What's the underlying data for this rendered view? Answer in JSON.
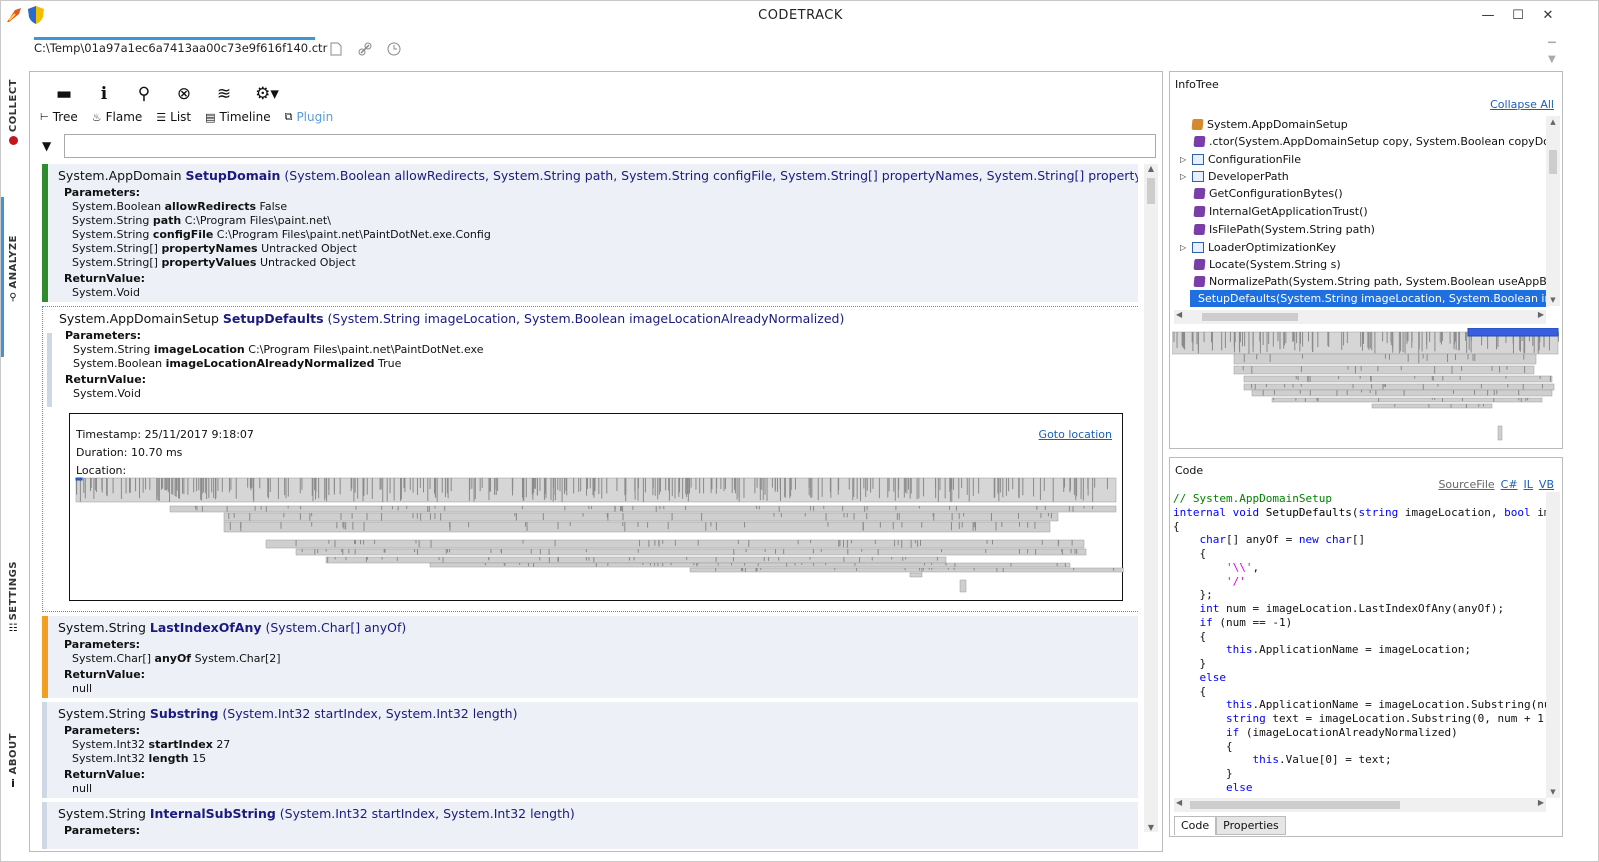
{
  "window": {
    "title": "CODETRACK",
    "controls": {
      "minimize": "—",
      "maximize": "☐",
      "close": "✕"
    }
  },
  "file_tab": {
    "label": "C:\\Temp\\01a97a1ec6a7413aa00c73e9f616f140.ctr"
  },
  "side_nav": [
    {
      "label": "COLLECT"
    },
    {
      "label": "ANALYZE"
    },
    {
      "label": "SETTINGS"
    },
    {
      "label": "ABOUT"
    }
  ],
  "view_tabs": [
    {
      "label": "Tree"
    },
    {
      "label": "Flame"
    },
    {
      "label": "List"
    },
    {
      "label": "Timeline"
    },
    {
      "label": "Plugin"
    }
  ],
  "filter": {
    "value": ""
  },
  "calls": [
    {
      "type": "System.AppDomain",
      "method": "SetupDomain",
      "params": "(System.Boolean allowRedirects, System.String path, System.String configFile, System.String[] propertyNames, System.String[] propertyValues)",
      "parameters_label": "Parameters:",
      "parameters": [
        {
          "ptype": "System.Boolean",
          "pname": "allowRedirects",
          "value": "False"
        },
        {
          "ptype": "System.String",
          "pname": "path",
          "value": "C:\\Program Files\\paint.net\\"
        },
        {
          "ptype": "System.String",
          "pname": "configFile",
          "value": "C:\\Program Files\\paint.net\\PaintDotNet.exe.Config"
        },
        {
          "ptype": "System.String[]",
          "pname": "propertyNames",
          "value": "Untracked Object"
        },
        {
          "ptype": "System.String[]",
          "pname": "propertyValues",
          "value": "Untracked Object"
        }
      ],
      "return_label": "ReturnValue:",
      "return_value": "System.Void",
      "bar_color": "#2e8b2e"
    },
    {
      "type": "System.AppDomainSetup",
      "method": "SetupDefaults",
      "params": "(System.String imageLocation, System.Boolean imageLocationAlreadyNormalized)",
      "parameters_label": "Parameters:",
      "parameters": [
        {
          "ptype": "System.String",
          "pname": "imageLocation",
          "value": "C:\\Program Files\\paint.net\\PaintDotNet.exe"
        },
        {
          "ptype": "System.Boolean",
          "pname": "imageLocationAlreadyNormalized",
          "value": "True"
        }
      ],
      "return_label": "ReturnValue:",
      "return_value": "System.Void",
      "details": {
        "timestamp": "Timestamp: 25/11/2017 9:18:07",
        "duration": "Duration: 10.70 ms",
        "location": "Location:",
        "goto": "Goto location"
      }
    },
    {
      "type": "System.String",
      "method": "LastIndexOfAny",
      "params": "(System.Char[] anyOf)",
      "parameters_label": "Parameters:",
      "parameters": [
        {
          "ptype": "System.Char[]",
          "pname": "anyOf",
          "value": "System.Char[2]"
        }
      ],
      "return_label": "ReturnValue:",
      "return_value": "null",
      "bar_color": "#f0a020"
    },
    {
      "type": "System.String",
      "method": "Substring",
      "params": "(System.Int32 startIndex, System.Int32 length)",
      "parameters_label": "Parameters:",
      "parameters": [
        {
          "ptype": "System.Int32",
          "pname": "startIndex",
          "value": "27"
        },
        {
          "ptype": "System.Int32",
          "pname": "length",
          "value": "15"
        }
      ],
      "return_label": "ReturnValue:",
      "return_value": "null"
    },
    {
      "type": "System.String",
      "method": "InternalSubString",
      "params": "(System.Int32 startIndex, System.Int32 length)",
      "parameters_label": "Parameters:"
    }
  ],
  "infotree": {
    "title": "InfoTree",
    "collapse_all": "Collapse All",
    "items": [
      {
        "label": "System.AppDomainSetup",
        "icon": "class",
        "expander": ""
      },
      {
        "label": ".ctor(System.AppDomainSetup copy, System.Boolean copyDomainBo",
        "icon": "method",
        "expander": ""
      },
      {
        "label": "ConfigurationFile",
        "icon": "property",
        "expander": "▷"
      },
      {
        "label": "DeveloperPath",
        "icon": "property",
        "expander": "▷"
      },
      {
        "label": "GetConfigurationBytes()",
        "icon": "method",
        "expander": ""
      },
      {
        "label": "InternalGetApplicationTrust()",
        "icon": "method",
        "expander": ""
      },
      {
        "label": "IsFilePath(System.String path)",
        "icon": "method",
        "expander": ""
      },
      {
        "label": "LoaderOptimizationKey",
        "icon": "property",
        "expander": "▷"
      },
      {
        "label": "Locate(System.String s)",
        "icon": "method",
        "expander": ""
      },
      {
        "label": "NormalizePath(System.String path, System.Boolean useAppBase)",
        "icon": "method",
        "expander": ""
      },
      {
        "label": "SetupDefaults(System.String imageLocation, System.Boolean image",
        "icon": "method",
        "expander": "",
        "selected": true
      }
    ]
  },
  "code": {
    "title": "Code",
    "links": [
      "SourceFile",
      "C#",
      "IL",
      "VB"
    ],
    "tabs": [
      "Code",
      "Properties"
    ]
  },
  "colors": {
    "accent": "#3c97d8",
    "selection": "#1e70e0",
    "green_bar": "#2e8b2e",
    "orange_bar": "#f0a020"
  }
}
